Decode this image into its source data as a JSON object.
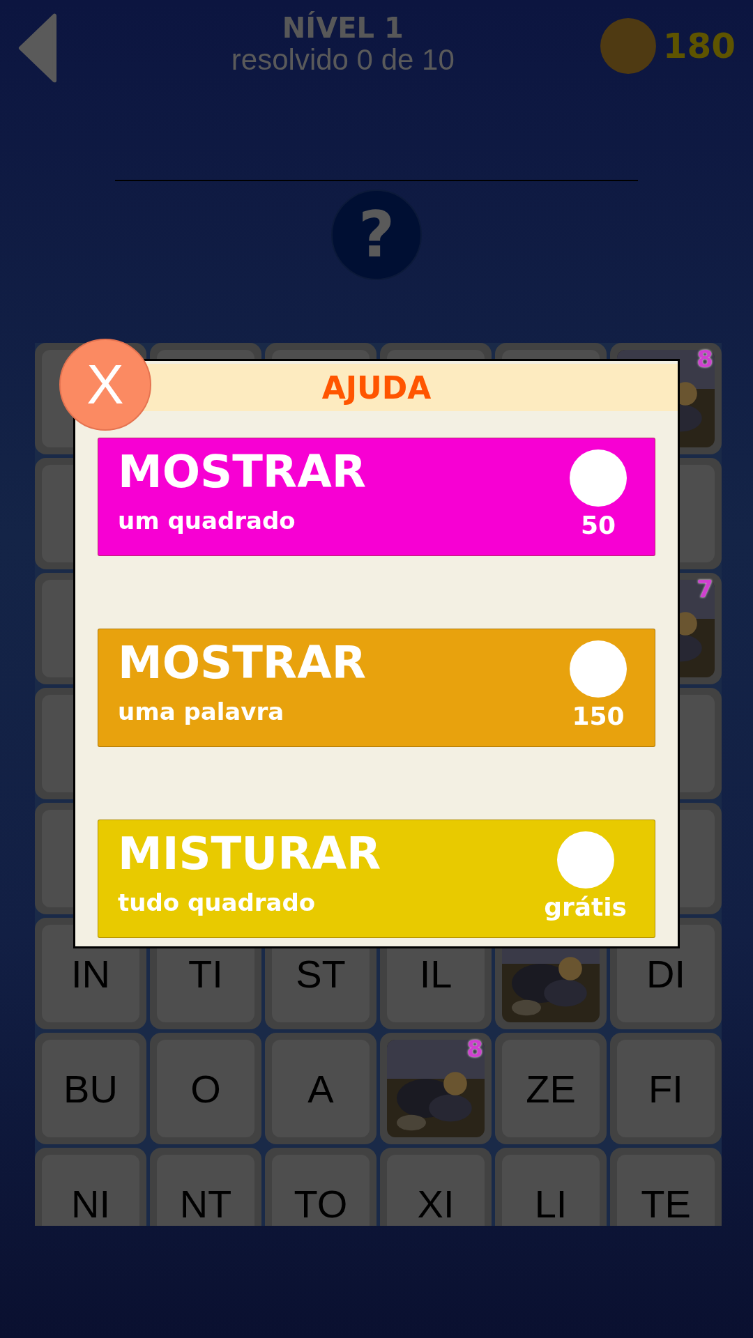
{
  "header": {
    "title": "NÍVEL 1",
    "subtitle": "resolvido 0 de 10",
    "coins": "180"
  },
  "hint": "?",
  "grid": [
    [
      {
        "kind": "tile"
      },
      {
        "kind": "tile"
      },
      {
        "kind": "tile"
      },
      {
        "kind": "tile"
      },
      {
        "kind": "tile"
      },
      {
        "kind": "picture",
        "badge": "8"
      }
    ],
    [
      {
        "kind": "tile"
      },
      {
        "kind": "gap"
      },
      {
        "kind": "gap"
      },
      {
        "kind": "gap"
      },
      {
        "kind": "gap"
      },
      {
        "kind": "tile"
      }
    ],
    [
      {
        "kind": "tile"
      },
      {
        "kind": "gap"
      },
      {
        "kind": "gap"
      },
      {
        "kind": "gap"
      },
      {
        "kind": "gap"
      },
      {
        "kind": "picture",
        "badge": "7"
      }
    ],
    [
      {
        "kind": "tile"
      },
      {
        "kind": "gap"
      },
      {
        "kind": "gap"
      },
      {
        "kind": "gap"
      },
      {
        "kind": "gap"
      },
      {
        "kind": "tile"
      }
    ],
    [
      {
        "kind": "tile"
      },
      {
        "kind": "gap"
      },
      {
        "kind": "gap"
      },
      {
        "kind": "gap"
      },
      {
        "kind": "gap"
      },
      {
        "kind": "tile"
      }
    ],
    [
      {
        "kind": "tile",
        "label": "IN"
      },
      {
        "kind": "tile",
        "label": "TI"
      },
      {
        "kind": "tile",
        "label": "ST"
      },
      {
        "kind": "tile",
        "label": "IL"
      },
      {
        "kind": "picture"
      },
      {
        "kind": "tile",
        "label": "DI"
      }
    ],
    [
      {
        "kind": "tile",
        "label": "BU"
      },
      {
        "kind": "tile",
        "label": "O"
      },
      {
        "kind": "tile",
        "label": "A"
      },
      {
        "kind": "picture",
        "badge": "8"
      },
      {
        "kind": "tile",
        "label": "ZE"
      },
      {
        "kind": "tile",
        "label": "FI"
      }
    ],
    [
      {
        "kind": "tile",
        "label": "NI"
      },
      {
        "kind": "tile",
        "label": "NT"
      },
      {
        "kind": "tile",
        "label": "TO"
      },
      {
        "kind": "tile",
        "label": "XI"
      },
      {
        "kind": "tile",
        "label": "LI"
      },
      {
        "kind": "tile",
        "label": "TE"
      }
    ]
  ],
  "dialog": {
    "close": "X",
    "title": "AJUDA",
    "options": [
      {
        "title": "MOSTRAR",
        "subtitle": "um quadrado",
        "cost": "50",
        "color": "#f700d3"
      },
      {
        "title": "MOSTRAR",
        "subtitle": "uma palavra",
        "cost": "150",
        "color": "#e8a20d"
      },
      {
        "title": "MISTURAR",
        "subtitle": "tudo quadrado",
        "cost": "grátis",
        "color": "#e8ca00"
      }
    ]
  }
}
